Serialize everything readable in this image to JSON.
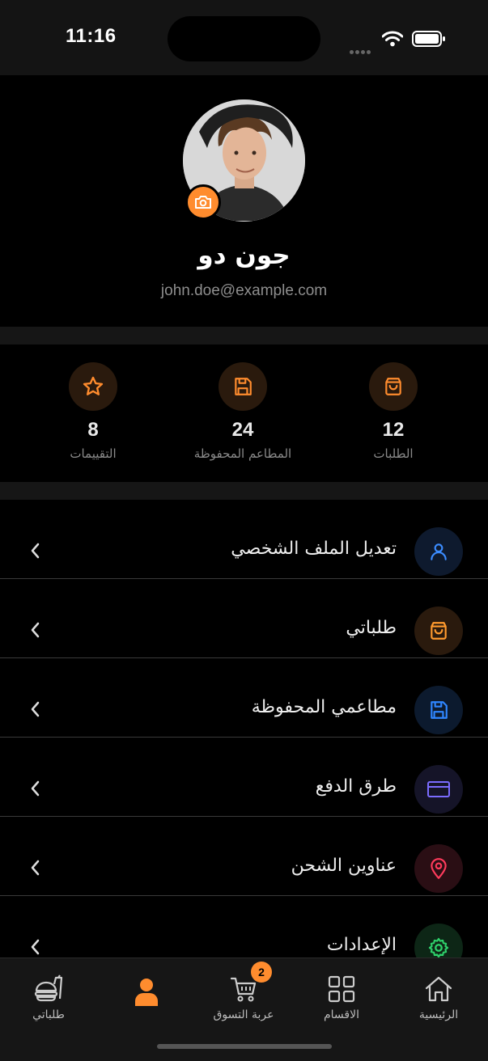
{
  "status_bar": {
    "time": "11:16"
  },
  "profile": {
    "name": "جون دو",
    "email": "john.doe@example.com",
    "avatar_icon": "user-photo",
    "camera_icon": "camera-icon"
  },
  "stats": [
    {
      "value": "12",
      "label": "الطلبات",
      "icon": "shopping-bag-icon"
    },
    {
      "value": "24",
      "label": "المطاعم المحفوظة",
      "icon": "save-icon"
    },
    {
      "value": "8",
      "label": "التقييمات",
      "icon": "star-icon"
    }
  ],
  "menu": {
    "items": [
      {
        "label": "تعديل الملف الشخصي",
        "icon": "user-icon",
        "color": "#3b8cff"
      },
      {
        "label": "طلباتي",
        "icon": "shopping-bag-icon",
        "color": "#ff9a2e"
      },
      {
        "label": "مطاعمي المحفوظة",
        "icon": "save-icon",
        "color": "#2f86ff"
      },
      {
        "label": "طرق الدفع",
        "icon": "credit-card-icon",
        "color": "#7b6cff"
      },
      {
        "label": "عناوين الشحن",
        "icon": "map-pin-icon",
        "color": "#ff3b5c"
      },
      {
        "label": "الإعدادات",
        "icon": "gear-icon",
        "color": "#2fd26b"
      }
    ]
  },
  "tab_bar": {
    "tabs": [
      {
        "label": "طلباتي",
        "icon": "food-icon"
      },
      {
        "label": "",
        "icon": "profile-icon",
        "active": true
      },
      {
        "label": "عربة التسوق",
        "icon": "cart-icon",
        "badge": "2"
      },
      {
        "label": "الاقسام",
        "icon": "grid-icon"
      },
      {
        "label": "الرئيسية",
        "icon": "home-icon"
      }
    ]
  },
  "colors": {
    "accent": "#ff8c2e",
    "background": "#000000",
    "surface": "#161616"
  }
}
